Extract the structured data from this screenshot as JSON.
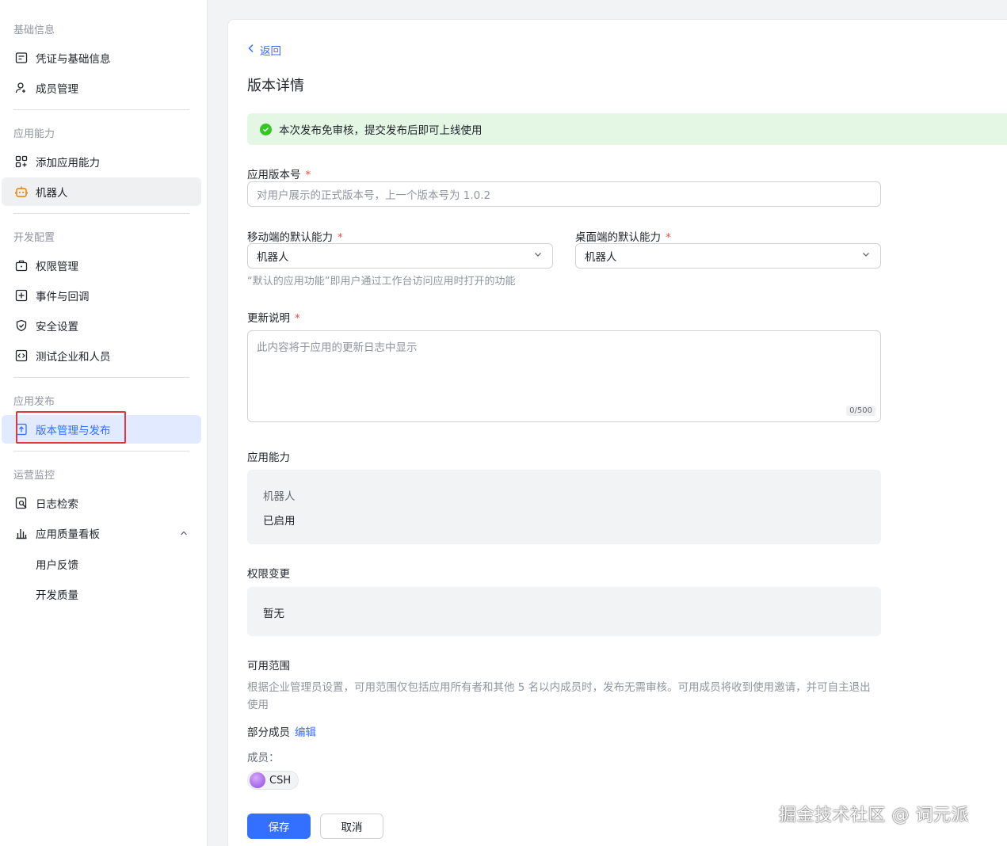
{
  "sidebar": {
    "sections": [
      {
        "title": "基础信息",
        "items": [
          "凭证与基础信息",
          "成员管理"
        ]
      },
      {
        "title": "应用能力",
        "items": [
          "添加应用能力",
          "机器人"
        ]
      },
      {
        "title": "开发配置",
        "items": [
          "权限管理",
          "事件与回调",
          "安全设置",
          "测试企业和人员"
        ]
      },
      {
        "title": "应用发布",
        "items": [
          "版本管理与发布"
        ]
      },
      {
        "title": "运营监控",
        "items": [
          "日志检索",
          "应用质量看板"
        ],
        "subitems": [
          "用户反馈",
          "开发质量"
        ]
      }
    ]
  },
  "main": {
    "back_label": "返回",
    "title": "版本详情",
    "alert": "本次发布免审核，提交发布后即可上线使用",
    "version_label": "应用版本号",
    "version_placeholder": "对用户展示的正式版本号，上一个版本号为 1.0.2",
    "mobile_label": "移动端的默认能力",
    "mobile_value": "机器人",
    "desktop_label": "桌面端的默认能力",
    "desktop_value": "机器人",
    "default_hint": "“默认的应用功能”即用户通过工作台访问应用时打开的功能",
    "notes_label": "更新说明",
    "notes_placeholder": "此内容将于应用的更新日志中显示",
    "notes_counter": "0/500",
    "capability_label": "应用能力",
    "capability_name": "机器人",
    "capability_status": "已启用",
    "permission_label": "权限变更",
    "permission_value": "暂无",
    "scope_label": "可用范围",
    "scope_desc": "根据企业管理员设置，可用范围仅包括应用所有者和其他 5 名以内成员时，发布无需审核。可用成员将收到使用邀请，并可自主退出使用",
    "scope_mode": "部分成员",
    "scope_edit": "编辑",
    "members_label": "成员：",
    "member_name": "CSH",
    "save_label": "保存",
    "cancel_label": "取消"
  },
  "watermark": "掘金技术社区 @ 词元派",
  "colors": {
    "accent": "#3370ff",
    "success": "#34c724",
    "required": "#f54a45",
    "highlight": "#e0373f"
  }
}
